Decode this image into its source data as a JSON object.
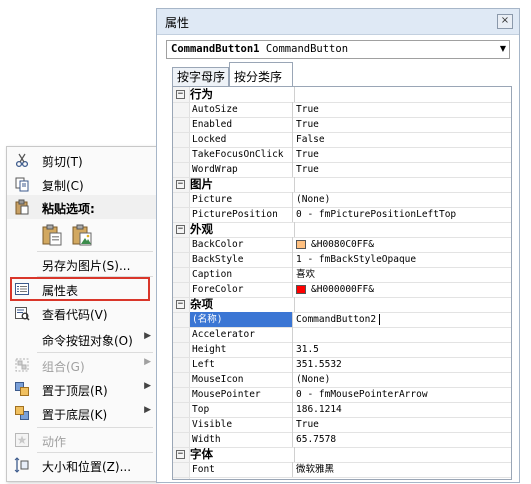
{
  "context_menu": {
    "items": [
      {
        "label": "剪切(T)",
        "icon": "scissors-icon",
        "disabled": false
      },
      {
        "label": "复制(C)",
        "icon": "copy-icon",
        "disabled": false
      },
      {
        "label": "粘贴选项:",
        "icon": "paste-icon",
        "disabled": false
      },
      {
        "label": "另存为图片(S)...",
        "icon": "",
        "disabled": false
      },
      {
        "label": "属性表",
        "icon": "property-sheet-icon",
        "disabled": false
      },
      {
        "label": "查看代码(V)",
        "icon": "view-code-icon",
        "disabled": false
      },
      {
        "label": "命令按钮对象(O)",
        "icon": "",
        "disabled": false,
        "submenu": true
      },
      {
        "label": "组合(G)",
        "icon": "group-icon",
        "disabled": true,
        "submenu": true
      },
      {
        "label": "置于顶层(R)",
        "icon": "bring-to-front-icon",
        "disabled": false,
        "submenu": true
      },
      {
        "label": "置于底层(K)",
        "icon": "send-to-back-icon",
        "disabled": false,
        "submenu": true
      },
      {
        "label": "动作",
        "icon": "action-icon",
        "disabled": true
      },
      {
        "label": "大小和位置(Z)...",
        "icon": "size-position-icon",
        "disabled": false
      }
    ],
    "highlighted_item": "属性表",
    "highlight_color": "#d9362a"
  },
  "properties_window": {
    "title": "属性",
    "close_label": "×",
    "object_name": "CommandButton1",
    "object_type": "CommandButton",
    "tabs": [
      "按字母序",
      "按分类序"
    ],
    "active_tab": "按分类序",
    "categories": [
      {
        "name": "行为",
        "toggle": "−",
        "rows": [
          {
            "name": "AutoSize",
            "value": "True"
          },
          {
            "name": "Enabled",
            "value": "True"
          },
          {
            "name": "Locked",
            "value": "False"
          },
          {
            "name": "TakeFocusOnClick",
            "value": "True"
          },
          {
            "name": "WordWrap",
            "value": "True"
          }
        ]
      },
      {
        "name": "图片",
        "toggle": "−",
        "rows": [
          {
            "name": "Picture",
            "value": "(None)"
          },
          {
            "name": "PicturePosition",
            "value": "0 - fmPicturePositionLeftTop"
          }
        ]
      },
      {
        "name": "外观",
        "toggle": "−",
        "rows": [
          {
            "name": "BackColor",
            "value": "&H0080C0FF&",
            "swatch": "#ffc080"
          },
          {
            "name": "BackStyle",
            "value": "1 - fmBackStyleOpaque"
          },
          {
            "name": "Caption",
            "value": "喜欢"
          },
          {
            "name": "ForeColor",
            "value": "&H000000FF&",
            "swatch": "#ff0000"
          }
        ]
      },
      {
        "name": "杂项",
        "toggle": "−",
        "rows": [
          {
            "name": "(名称)",
            "value": "CommandButton2",
            "selected": true
          },
          {
            "name": "Accelerator",
            "value": ""
          },
          {
            "name": "Height",
            "value": "31.5"
          },
          {
            "name": "Left",
            "value": "351.5532"
          },
          {
            "name": "MouseIcon",
            "value": "(None)"
          },
          {
            "name": "MousePointer",
            "value": "0 - fmMousePointerArrow"
          },
          {
            "name": "Top",
            "value": "186.1214"
          },
          {
            "name": "Visible",
            "value": "True"
          },
          {
            "name": "Width",
            "value": "65.7578"
          }
        ]
      },
      {
        "name": "字体",
        "toggle": "−",
        "rows": [
          {
            "name": "Font",
            "value": "微软雅黑"
          }
        ]
      }
    ],
    "selected_color": "#3b76d4"
  }
}
